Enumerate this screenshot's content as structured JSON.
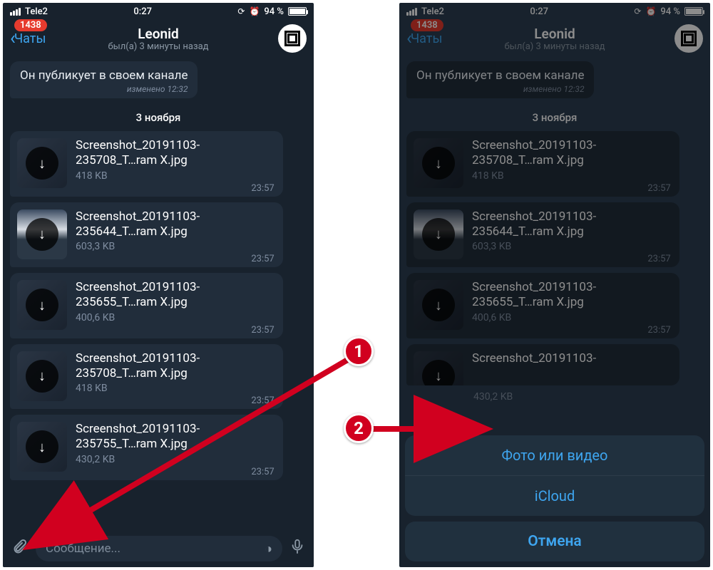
{
  "status": {
    "carrier": "Tele2",
    "time": "0:27",
    "battery_pct": "94 %",
    "lock_glyph": "⦾",
    "alarm_glyph": "⏰"
  },
  "nav": {
    "back_label": "Чаты",
    "badge": "1438",
    "title": "Leonid",
    "subtitle": "был(а) 3 минуты назад"
  },
  "first_message": {
    "text": "Он публикует в своем канале",
    "meta": "изменено 12:32"
  },
  "date_separator": "3 ноября",
  "files": [
    {
      "name_l1": "Screenshot_20191103-",
      "name_l2": "235708_T…ram X.jpg",
      "size": "418 KB",
      "time": "23:57",
      "thumb_variant": ""
    },
    {
      "name_l1": "Screenshot_20191103-",
      "name_l2": "235644_T…ram X.jpg",
      "size": "603,3 KB",
      "time": "23:57",
      "thumb_variant": "var2"
    },
    {
      "name_l1": "Screenshot_20191103-",
      "name_l2": "235655_T…ram X.jpg",
      "size": "400,6 KB",
      "time": "23:57",
      "thumb_variant": ""
    },
    {
      "name_l1": "Screenshot_20191103-",
      "name_l2": "235708_T…ram X.jpg",
      "size": "418 KB",
      "time": "23:57",
      "thumb_variant": ""
    },
    {
      "name_l1": "Screenshot_20191103-",
      "name_l2": "235755_T…ram X.jpg",
      "size": "430,2 KB",
      "time": "23:57",
      "thumb_variant": ""
    }
  ],
  "right_files_extra": {
    "partial_name": "Screenshot_20191103-",
    "last_size": "430,2 KB"
  },
  "input": {
    "placeholder": "Сообщение..."
  },
  "sheet": {
    "option_photo": "Фото или видео",
    "option_icloud": "iCloud",
    "cancel": "Отмена"
  },
  "annotations": {
    "num1": "1",
    "num2": "2"
  }
}
